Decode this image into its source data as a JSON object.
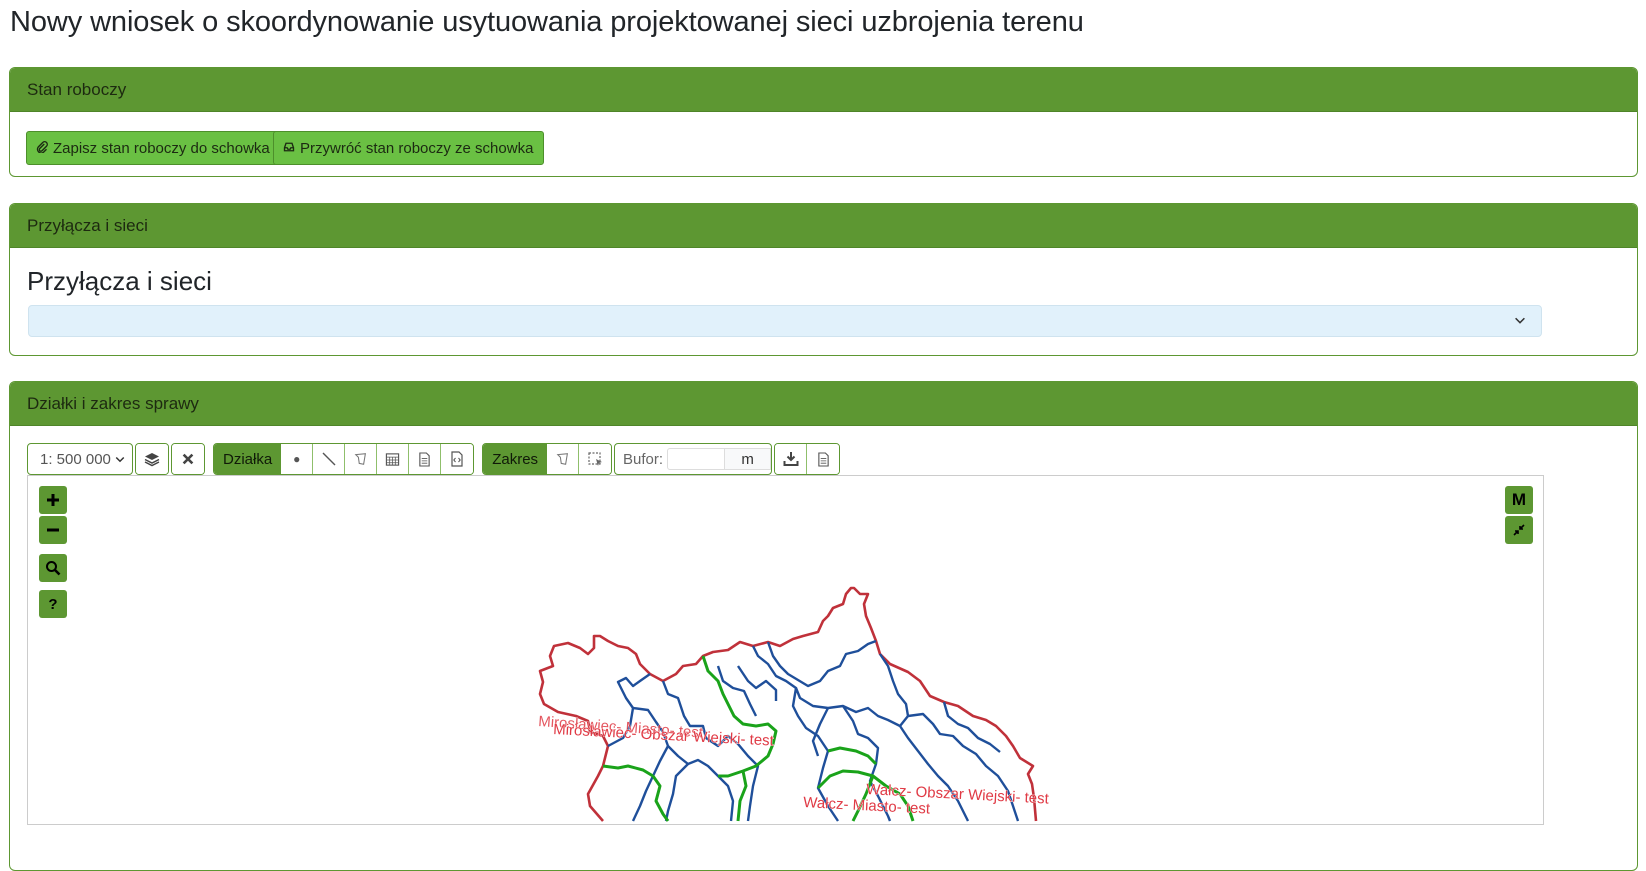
{
  "page": {
    "title": "Nowy wniosek o skoordynowanie usytuowania projektowanej sieci uzbrojenia terenu"
  },
  "draft": {
    "header": "Stan roboczy",
    "save_label": "Zapisz stan roboczy do schowka",
    "restore_label": "Przywróć stan roboczy ze schowka"
  },
  "connections": {
    "header": "Przyłącza i sieci",
    "heading": "Przyłącza i sieci",
    "select_value": ""
  },
  "parcels": {
    "header": "Działki i zakres sprawy",
    "toolbar": {
      "scale_value": "1: 500 000",
      "parcel_label": "Działka",
      "scope_label": "Zakres",
      "buffer_label": "Bufor:",
      "buffer_value": "",
      "buffer_unit": "m"
    },
    "map": {
      "mode_button": "M",
      "regions": [
        "Mirosławiec- Miasto- test",
        "Mirosławiec- Obszar Wiejski- test",
        "Wałcz- Obszar Wiejski- test",
        "Wałcz- Miasto- test"
      ],
      "colors": {
        "outer_boundary": "#c0313a",
        "inner_boundary": "#1f4f9a",
        "green_boundary": "#1aa31a",
        "label": "#e03a45"
      }
    }
  },
  "colors": {
    "accent": "#5d9732",
    "button": "#6ac043"
  }
}
